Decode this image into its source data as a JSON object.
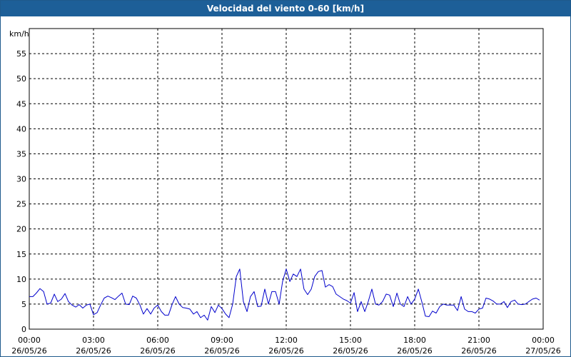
{
  "window": {
    "title": "Velocidad del viento 0-60 [km/h]"
  },
  "chart_data": {
    "type": "line",
    "title": "Velocidad del viento 0-60 [km/h]",
    "ylabel": "km/h",
    "ylim": [
      0,
      60
    ],
    "yticks": [
      0,
      5,
      10,
      15,
      20,
      25,
      30,
      35,
      40,
      45,
      50,
      55
    ],
    "xlim_hours": [
      0,
      24
    ],
    "xticks": [
      {
        "time": "00:00",
        "date": "26/05/26"
      },
      {
        "time": "03:00",
        "date": "26/05/26"
      },
      {
        "time": "06:00",
        "date": "26/05/26"
      },
      {
        "time": "09:00",
        "date": "26/05/26"
      },
      {
        "time": "12:00",
        "date": "26/05/26"
      },
      {
        "time": "15:00",
        "date": "26/05/26"
      },
      {
        "time": "18:00",
        "date": "26/05/26"
      },
      {
        "time": "21:00",
        "date": "26/05/26"
      },
      {
        "time": "00:00",
        "date": "27/05/26"
      }
    ],
    "grid": true,
    "line_color": "#0000cc",
    "series": [
      {
        "x_hours": [
          0.0,
          0.17,
          0.33,
          0.5,
          0.67,
          0.83,
          1.0,
          1.17,
          1.33,
          1.5,
          1.67,
          1.83,
          2.0,
          2.17,
          2.33,
          2.5,
          2.67,
          2.83,
          3.0,
          3.17,
          3.33,
          3.5,
          3.67,
          3.83,
          4.0,
          4.17,
          4.33,
          4.5,
          4.67,
          4.83,
          5.0,
          5.17,
          5.33,
          5.5,
          5.67,
          5.83,
          6.0,
          6.17,
          6.33,
          6.5,
          6.67,
          6.83,
          7.0,
          7.17,
          7.33,
          7.5,
          7.67,
          7.83,
          8.0,
          8.17,
          8.33,
          8.5,
          8.67,
          8.83,
          9.0,
          9.17,
          9.33,
          9.5,
          9.67,
          9.83,
          10.0,
          10.17,
          10.33,
          10.5,
          10.67,
          10.83,
          11.0,
          11.17,
          11.33,
          11.5,
          11.67,
          11.83,
          12.0,
          12.17,
          12.33,
          12.5,
          12.67,
          12.83,
          13.0,
          13.17,
          13.33,
          13.5,
          13.67,
          13.83,
          14.0,
          14.17,
          14.33,
          14.5,
          14.67,
          14.83,
          15.0,
          15.17,
          15.33,
          15.5,
          15.67,
          15.83,
          16.0,
          16.17,
          16.33,
          16.5,
          16.67,
          16.83,
          17.0,
          17.17,
          17.33,
          17.5,
          17.67,
          17.83,
          18.0,
          18.17,
          18.33,
          18.5,
          18.67,
          18.83,
          19.0,
          19.17,
          19.33,
          19.5,
          19.67,
          19.83,
          20.0,
          20.17,
          20.33,
          20.5,
          20.67,
          20.83,
          21.0,
          21.17,
          21.33,
          21.5,
          21.67,
          21.83,
          22.0,
          22.17,
          22.33,
          22.5,
          22.67,
          22.83,
          23.0,
          23.17,
          23.33,
          23.5,
          23.67,
          23.83
        ],
        "values": [
          6.5,
          6.5,
          7.2,
          8.1,
          7.5,
          5.0,
          5.2,
          7.0,
          5.5,
          6.0,
          7.1,
          5.5,
          4.8,
          4.4,
          4.9,
          4.2,
          4.8,
          5.0,
          2.9,
          3.3,
          4.8,
          6.2,
          6.6,
          6.3,
          5.9,
          6.6,
          7.2,
          5.0,
          4.9,
          6.6,
          6.2,
          4.8,
          3.0,
          4.1,
          3.0,
          4.2,
          4.8,
          3.5,
          2.8,
          2.8,
          4.9,
          6.5,
          5.0,
          4.3,
          4.2,
          4.0,
          3.0,
          3.5,
          2.3,
          2.8,
          1.8,
          4.5,
          3.3,
          4.8,
          4.1,
          3.0,
          2.3,
          5.0,
          10.5,
          12.0,
          5.5,
          3.5,
          6.5,
          7.5,
          4.5,
          4.6,
          8.0,
          5.0,
          7.5,
          7.5,
          5.0,
          9.5,
          12.0,
          9.5,
          11.0,
          10.5,
          12.0,
          8.0,
          6.9,
          8.0,
          10.5,
          11.5,
          11.7,
          8.4,
          8.9,
          8.5,
          7.0,
          6.5,
          6.0,
          5.7,
          5.2,
          7.3,
          3.5,
          5.5,
          3.5,
          5.5,
          8.0,
          5.0,
          4.8,
          5.5,
          7.0,
          6.8,
          4.5,
          7.2,
          5.0,
          4.5,
          6.5,
          5.0,
          6.0,
          8.0,
          5.5,
          2.6,
          2.5,
          3.6,
          3.2,
          4.5,
          5.0,
          4.8,
          4.8,
          4.8,
          3.7,
          6.5,
          4.0,
          3.5,
          3.5,
          3.2,
          4.0,
          4.2,
          6.2,
          6.0,
          5.6,
          5.0,
          5.0,
          5.5,
          4.3,
          5.5,
          5.8,
          5.0,
          4.9,
          5.0,
          5.5,
          6.0,
          6.2,
          5.8
        ]
      }
    ]
  }
}
